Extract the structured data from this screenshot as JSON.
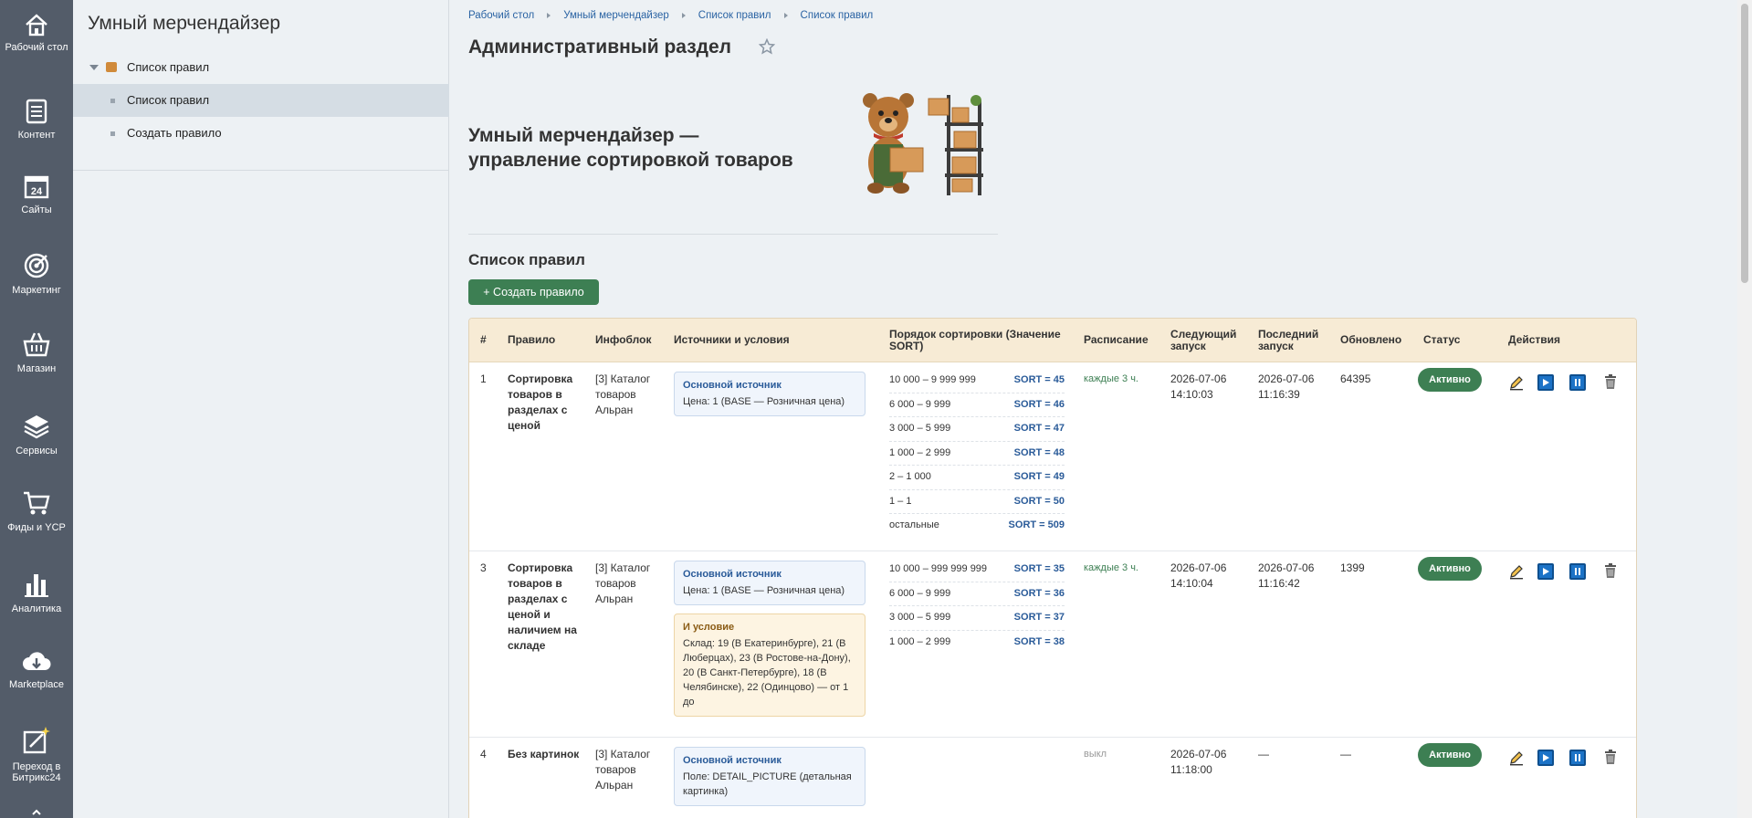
{
  "sidebar": {
    "items": [
      {
        "label": "Рабочий стол",
        "icon": "home-icon"
      },
      {
        "label": "Контент",
        "icon": "document-icon"
      },
      {
        "label": "Сайты",
        "icon": "calendar-24-icon"
      },
      {
        "label": "Маркетинг",
        "icon": "target-icon"
      },
      {
        "label": "Магазин",
        "icon": "basket-icon"
      },
      {
        "label": "Сервисы",
        "icon": "layers-icon"
      },
      {
        "label": "Фиды и YCP",
        "icon": "cart-icon"
      },
      {
        "label": "Аналитика",
        "icon": "bar-chart-icon"
      },
      {
        "label": "Marketplace",
        "icon": "cloud-download-icon"
      },
      {
        "label": "Переход в Битрикс24",
        "icon": "magic-edit-icon"
      }
    ]
  },
  "submenu": {
    "title": "Умный мерчендайзер",
    "tree": [
      {
        "label": "Список правил",
        "level": 0,
        "expanded": true
      },
      {
        "label": "Список правил",
        "level": 1,
        "active": true
      },
      {
        "label": "Создать правило",
        "level": 1
      }
    ]
  },
  "breadcrumbs": [
    "Рабочий стол",
    "Умный мерчендайзер",
    "Список правил",
    "Список правил"
  ],
  "page_title": "Административный раздел",
  "banner": {
    "line1": "Умный мерчендайзер —",
    "line2": "управление сортировкой товаров"
  },
  "list_title": "Список правил",
  "create_button": "+ Создать правило",
  "table": {
    "headers": {
      "num": "#",
      "rule": "Правило",
      "iblock": "Инфоблок",
      "sources": "Источники и условия",
      "sort_order": "Порядок сортировки (Значение SORT)",
      "schedule": "Расписание",
      "next_run": "Следующий запуск",
      "last_run": "Последний запуск",
      "updated": "Обновлено",
      "status": "Статус",
      "actions": "Действия"
    },
    "rows": [
      {
        "num": "1",
        "rule": "Сортировка товаров в разделах с ценой",
        "iblock": "[3] Каталог товаров Альран",
        "source_title": "Основной источник",
        "source_desc": "Цена: 1 (BASE — Розничная цена)",
        "sorts": [
          {
            "range": "10 000 – 9 999 999",
            "value": "SORT = 45"
          },
          {
            "range": "6 000 – 9 999",
            "value": "SORT = 46"
          },
          {
            "range": "3 000 – 5 999",
            "value": "SORT = 47"
          },
          {
            "range": "1 000 – 2 999",
            "value": "SORT = 48"
          },
          {
            "range": "2 – 1 000",
            "value": "SORT = 49"
          },
          {
            "range": "1 – 1",
            "value": "SORT = 50"
          },
          {
            "range": "остальные",
            "value": "SORT = 509"
          }
        ],
        "schedule": "каждые 3 ч.",
        "next_run": "2026-07-06 14:10:03",
        "last_run": "2026-07-06 11:16:39",
        "updated": "64395",
        "status": "Активно"
      },
      {
        "num": "3",
        "rule": "Сортировка товаров в разделах с ценой и наличием на складе",
        "iblock": "[3] Каталог товаров Альран",
        "source_title": "Основной источник",
        "source_desc": "Цена: 1 (BASE — Розничная цена)",
        "cond_title": "И условие",
        "cond_desc": "Склад: 19 (В Екатеринбурге), 21 (В Люберцах), 23 (В Ростове-на-Дону), 20 (В Санкт-Петербурге), 18 (В Челябинске), 22 (Одинцово) — от 1 до",
        "sorts": [
          {
            "range": "10 000 – 999 999 999",
            "value": "SORT = 35"
          },
          {
            "range": "6 000 – 9 999",
            "value": "SORT = 36"
          },
          {
            "range": "3 000 – 5 999",
            "value": "SORT = 37"
          },
          {
            "range": "1 000 – 2 999",
            "value": "SORT = 38"
          }
        ],
        "schedule": "каждые 3 ч.",
        "next_run": "2026-07-06 14:10:04",
        "last_run": "2026-07-06 11:16:42",
        "updated": "1399",
        "status": "Активно"
      },
      {
        "num": "4",
        "rule": "Без картинок",
        "iblock": "[3] Каталог товаров Альран",
        "source_title": "Основной источник",
        "source_desc": "Поле: DETAIL_PICTURE (детальная картинка)",
        "schedule": "выкл",
        "next_run": "2026-07-06 11:18:00",
        "last_run": "—",
        "updated": "—",
        "status": "Активно"
      }
    ]
  },
  "colors": {
    "sidebar_bg": "#535c69",
    "accent_green": "#3d7f53",
    "table_header_bg": "#f7ebd5",
    "link_blue": "#2a63a3"
  }
}
